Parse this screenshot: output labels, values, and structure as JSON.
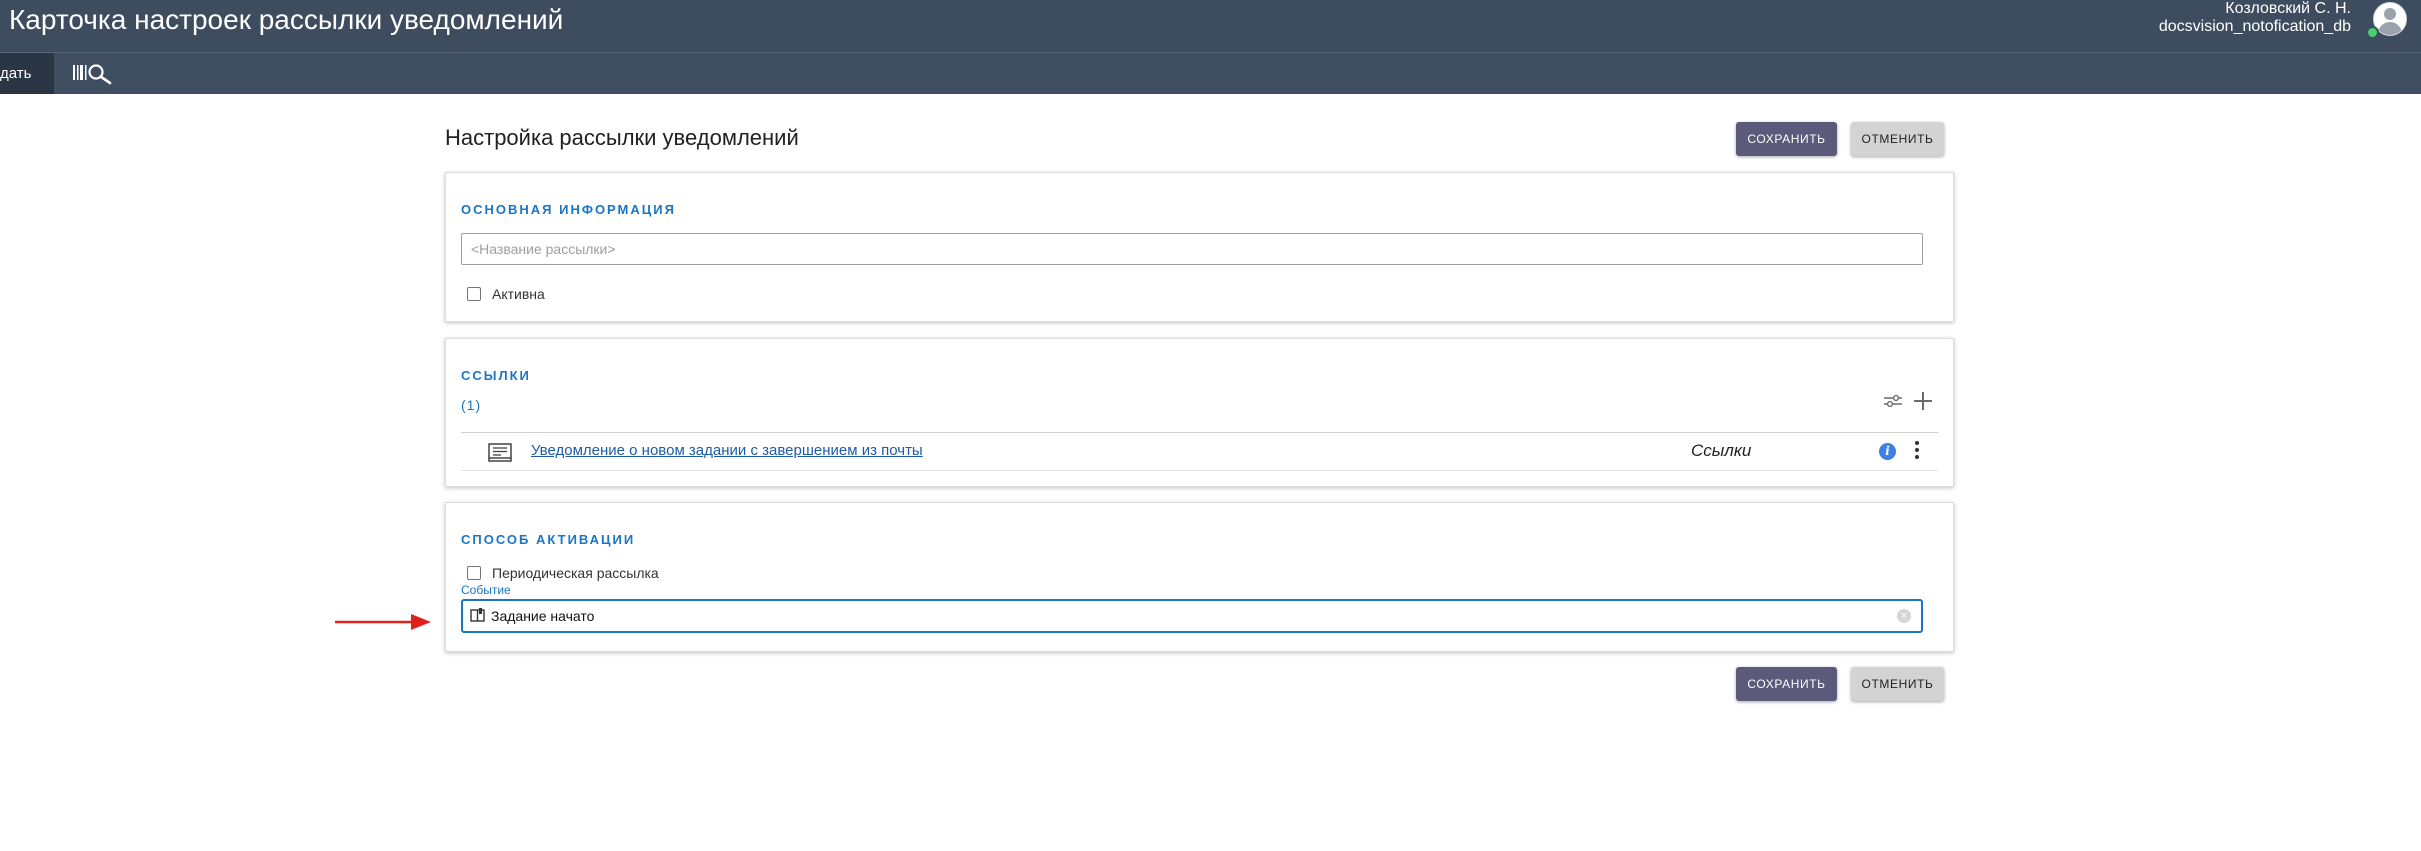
{
  "header": {
    "title": "Карточка настроек рассылки уведомлений",
    "user_name": "Козловский С. Н.",
    "user_db": "docsvision_notofication_db"
  },
  "toolbar": {
    "create_label": "дать",
    "search_icon": "barcode-search-icon"
  },
  "page": {
    "title": "Настройка рассылки уведомлений",
    "save_label": "СОХРАНИТЬ",
    "cancel_label": "ОТМЕНИТЬ"
  },
  "main_info": {
    "section_title": "ОСНОВНАЯ ИНФОРМАЦИЯ",
    "name_placeholder": "<Название рассылки>",
    "name_value": "",
    "active_label": "Активна",
    "active_checked": false
  },
  "links": {
    "section_title": "ССЫЛКИ",
    "count": "(1)",
    "items": [
      {
        "icon": "card-icon",
        "title": "Уведомление о новом задании с завершением из почты",
        "type": "Ссылки"
      }
    ]
  },
  "activation": {
    "section_title": "СПОСОБ АКТИВАЦИИ",
    "periodic_label": "Периодическая рассылка",
    "periodic_checked": false,
    "event_label": "Событие",
    "event_value": "Задание начато"
  },
  "colors": {
    "header_bg": "#3d4c5e",
    "accent": "#1976c7",
    "save_button": "#5c5a7a",
    "cancel_button": "#d3d3d3",
    "annotation_arrow": "#e0201b"
  }
}
